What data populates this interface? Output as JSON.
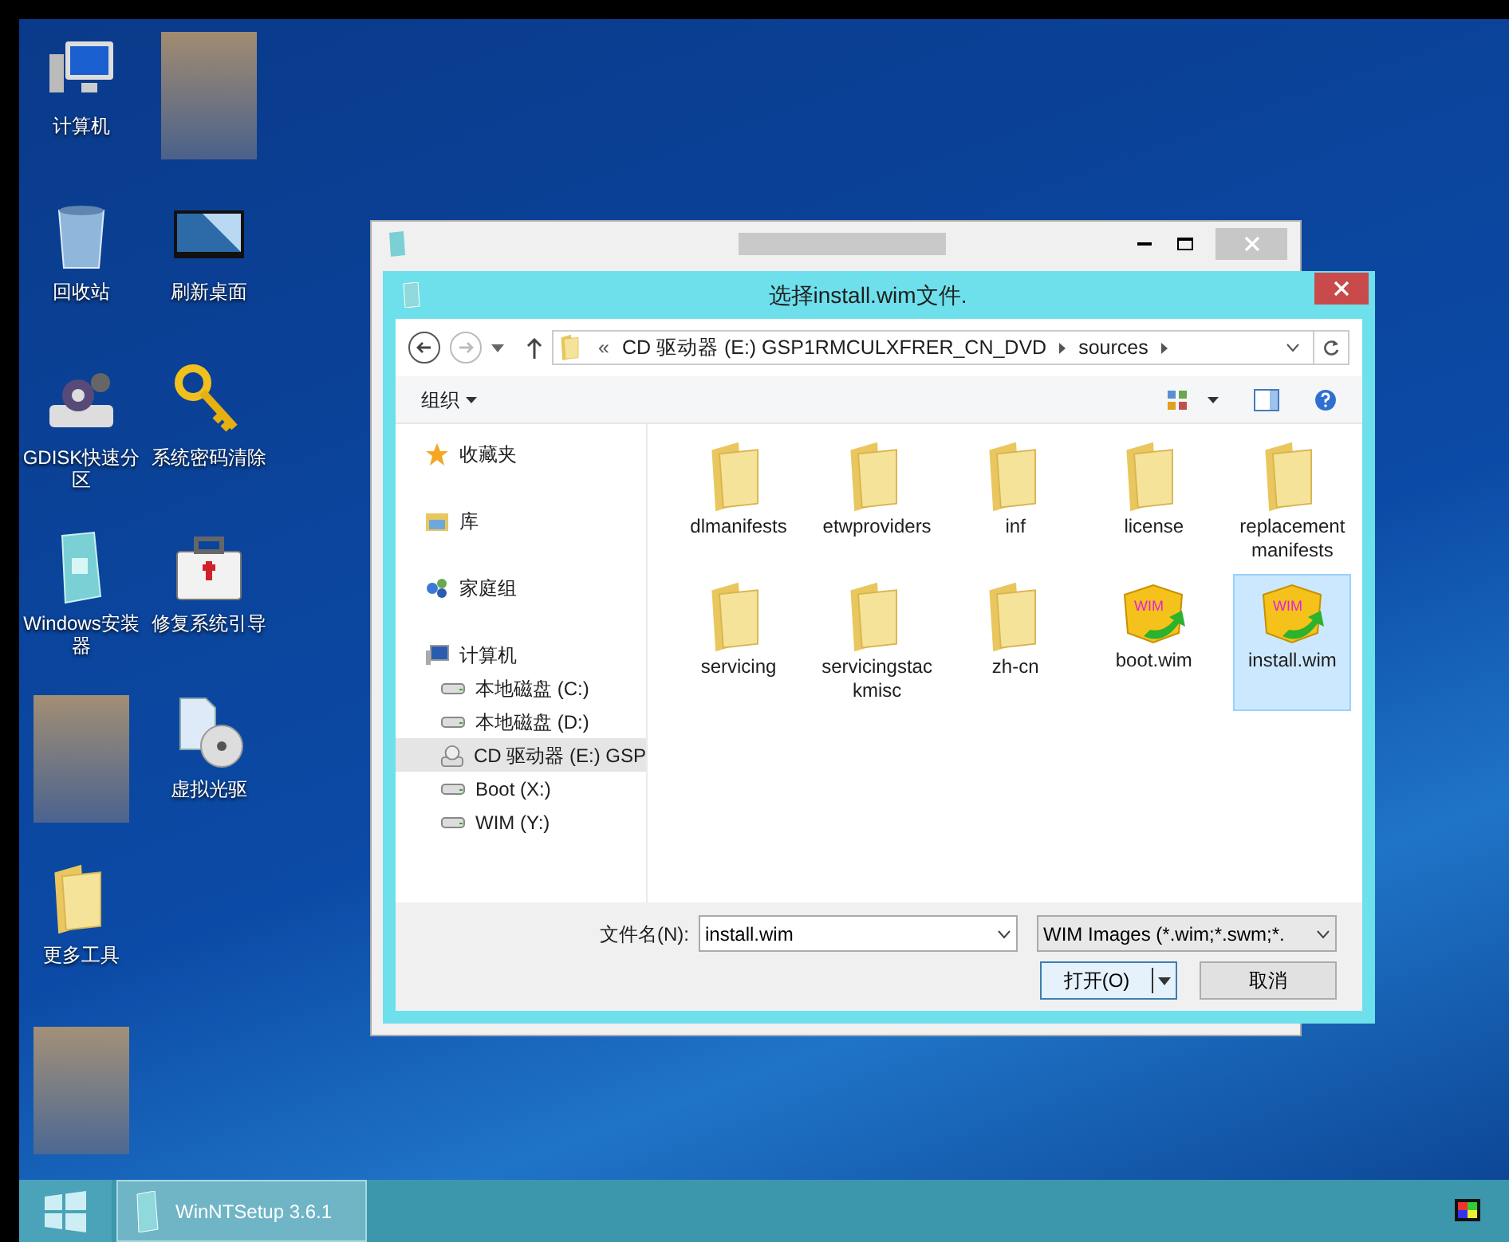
{
  "desktop_columns": [
    [
      {
        "kind": "computer",
        "label": "计算机"
      },
      {
        "kind": "trash",
        "label": "回收站"
      },
      {
        "kind": "disk-gear",
        "label": "GDISK快速分区"
      },
      {
        "kind": "installer",
        "label": "Windows安装器"
      },
      {
        "kind": "blurred"
      },
      {
        "kind": "folder",
        "label": "更多工具"
      },
      {
        "kind": "blurred"
      }
    ],
    [
      {
        "kind": "blurred"
      },
      {
        "kind": "screen",
        "label": "刷新桌面"
      },
      {
        "kind": "key",
        "label": "系统密码清除"
      },
      {
        "kind": "medkit",
        "label": "修复系统引导"
      },
      {
        "kind": "disc",
        "label": "虚拟光驱"
      }
    ]
  ],
  "dialog": {
    "title": "选择install.wim文件.",
    "address": {
      "overflow": "«",
      "segments": [
        "CD 驱动器 (E:) GSP1RMCULXFRER_CN_DVD",
        "sources"
      ]
    },
    "toolbar": {
      "organize": "组织"
    },
    "nav": [
      {
        "kind": "star",
        "label": "收藏夹",
        "selected": false
      },
      {
        "kind": "library",
        "label": "库",
        "selected": false
      },
      {
        "kind": "homegroup",
        "label": "家庭组",
        "selected": false
      },
      {
        "kind": "computer",
        "label": "计算机",
        "selected": false,
        "children": [
          {
            "kind": "drive",
            "label": "本地磁盘 (C:)",
            "selected": false
          },
          {
            "kind": "drive",
            "label": "本地磁盘 (D:)",
            "selected": false
          },
          {
            "kind": "cd",
            "label": "CD 驱动器 (E:) GSP",
            "selected": true
          },
          {
            "kind": "drive",
            "label": "Boot (X:)",
            "selected": false
          },
          {
            "kind": "drive",
            "label": "WIM (Y:)",
            "selected": false
          }
        ]
      }
    ],
    "files": [
      {
        "kind": "folder",
        "name": "dlmanifests",
        "selected": false
      },
      {
        "kind": "folder",
        "name": "etwproviders",
        "selected": false
      },
      {
        "kind": "folder",
        "name": "inf",
        "selected": false
      },
      {
        "kind": "folder",
        "name": "license",
        "selected": false
      },
      {
        "kind": "folder",
        "name": "replacementmanifests",
        "selected": false
      },
      {
        "kind": "folder",
        "name": "servicing",
        "selected": false
      },
      {
        "kind": "folder",
        "name": "servicingstackmisc",
        "selected": false
      },
      {
        "kind": "folder",
        "name": "zh-cn",
        "selected": false
      },
      {
        "kind": "wim",
        "icon_text": "WIM",
        "name": "boot.wim",
        "selected": false
      },
      {
        "kind": "wim",
        "icon_text": "WIM",
        "name": "install.wim",
        "selected": true
      }
    ],
    "filename_label": "文件名(N):",
    "filename_value": "install.wim",
    "filter_value": "WIM Images (*.wim;*.swm;*.",
    "open_button": "打开(O)",
    "cancel_button": "取消"
  },
  "taskbar": {
    "tasks": [
      {
        "label": "WinNTSetup 3.6.1",
        "selected": true
      }
    ]
  }
}
